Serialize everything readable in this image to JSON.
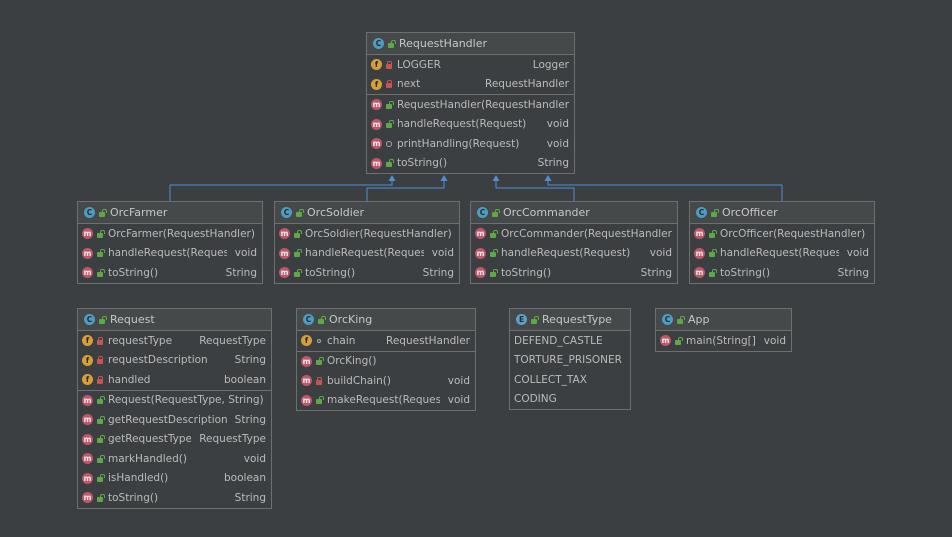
{
  "colors": {
    "background": "#3c3f41",
    "arrow": "#4f8fd8",
    "class_badge": "#4d9cc4",
    "field_badge": "#d79f39",
    "method_badge": "#c0566b"
  },
  "classes": [
    {
      "key": "request-handler",
      "name": "RequestHandler",
      "kind": "class",
      "sections": [
        [
          {
            "badge": "f",
            "vis": "priv",
            "name": "LOGGER",
            "type": "Logger"
          },
          {
            "badge": "f",
            "vis": "priv",
            "name": "next",
            "type": "RequestHandler"
          }
        ],
        [
          {
            "badge": "m",
            "vis": "pub",
            "name": "RequestHandler(RequestHandler)",
            "type": ""
          },
          {
            "badge": "m",
            "vis": "pub",
            "name": "handleRequest(Request)",
            "type": "void"
          },
          {
            "badge": "m",
            "vis": "prot",
            "name": "printHandling(Request)",
            "type": "void"
          },
          {
            "badge": "m",
            "vis": "pub",
            "name": "toString()",
            "type": "String"
          }
        ]
      ]
    },
    {
      "key": "orc-farmer",
      "name": "OrcFarmer",
      "kind": "class",
      "sections": [
        [
          {
            "badge": "m",
            "vis": "pub",
            "name": "OrcFarmer(RequestHandler)",
            "type": ""
          },
          {
            "badge": "m",
            "vis": "pub",
            "name": "handleRequest(Request)",
            "type": "void"
          },
          {
            "badge": "m",
            "vis": "pub",
            "name": "toString()",
            "type": "String"
          }
        ]
      ]
    },
    {
      "key": "orc-soldier",
      "name": "OrcSoldier",
      "kind": "class",
      "sections": [
        [
          {
            "badge": "m",
            "vis": "pub",
            "name": "OrcSoldier(RequestHandler)",
            "type": ""
          },
          {
            "badge": "m",
            "vis": "pub",
            "name": "handleRequest(Request)",
            "type": "void"
          },
          {
            "badge": "m",
            "vis": "pub",
            "name": "toString()",
            "type": "String"
          }
        ]
      ]
    },
    {
      "key": "orc-commander",
      "name": "OrcCommander",
      "kind": "class",
      "sections": [
        [
          {
            "badge": "m",
            "vis": "pub",
            "name": "OrcCommander(RequestHandler)",
            "type": ""
          },
          {
            "badge": "m",
            "vis": "pub",
            "name": "handleRequest(Request)",
            "type": "void"
          },
          {
            "badge": "m",
            "vis": "pub",
            "name": "toString()",
            "type": "String"
          }
        ]
      ]
    },
    {
      "key": "orc-officer",
      "name": "OrcOfficer",
      "kind": "class",
      "sections": [
        [
          {
            "badge": "m",
            "vis": "pub",
            "name": "OrcOfficer(RequestHandler)",
            "type": ""
          },
          {
            "badge": "m",
            "vis": "pub",
            "name": "handleRequest(Request)",
            "type": "void"
          },
          {
            "badge": "m",
            "vis": "pub",
            "name": "toString()",
            "type": "String"
          }
        ]
      ]
    },
    {
      "key": "request",
      "name": "Request",
      "kind": "class",
      "sections": [
        [
          {
            "badge": "f",
            "vis": "priv",
            "name": "requestType",
            "type": "RequestType"
          },
          {
            "badge": "f",
            "vis": "priv",
            "name": "requestDescription",
            "type": "String"
          },
          {
            "badge": "f",
            "vis": "priv",
            "name": "handled",
            "type": "boolean"
          }
        ],
        [
          {
            "badge": "m",
            "vis": "pub",
            "name": "Request(RequestType, String)",
            "type": ""
          },
          {
            "badge": "m",
            "vis": "pub",
            "name": "getRequestDescription()",
            "type": "String"
          },
          {
            "badge": "m",
            "vis": "pub",
            "name": "getRequestType()",
            "type": "RequestType"
          },
          {
            "badge": "m",
            "vis": "pub",
            "name": "markHandled()",
            "type": "void"
          },
          {
            "badge": "m",
            "vis": "pub",
            "name": "isHandled()",
            "type": "boolean"
          },
          {
            "badge": "m",
            "vis": "pub",
            "name": "toString()",
            "type": "String"
          }
        ]
      ]
    },
    {
      "key": "orc-king",
      "name": "OrcKing",
      "kind": "class",
      "sections": [
        [
          {
            "badge": "f",
            "vis": "pkg",
            "name": "chain",
            "type": "RequestHandler"
          }
        ],
        [
          {
            "badge": "m",
            "vis": "pub",
            "name": "OrcKing()",
            "type": ""
          },
          {
            "badge": "m",
            "vis": "priv",
            "name": "buildChain()",
            "type": "void"
          },
          {
            "badge": "m",
            "vis": "pub",
            "name": "makeRequest(Request)",
            "type": "void"
          }
        ]
      ]
    },
    {
      "key": "request-type",
      "name": "RequestType",
      "kind": "enum",
      "sections": [
        [
          {
            "badge": "",
            "vis": "",
            "name": "DEFEND_CASTLE",
            "type": ""
          },
          {
            "badge": "",
            "vis": "",
            "name": "TORTURE_PRISONER",
            "type": ""
          },
          {
            "badge": "",
            "vis": "",
            "name": "COLLECT_TAX",
            "type": ""
          },
          {
            "badge": "",
            "vis": "",
            "name": "CODING",
            "type": ""
          }
        ]
      ]
    },
    {
      "key": "app",
      "name": "App",
      "kind": "class",
      "sections": [
        [
          {
            "badge": "m",
            "vis": "pub",
            "name": "main(String[])",
            "type": "void"
          }
        ]
      ]
    }
  ],
  "inheritance": [
    {
      "from": "orc-farmer",
      "to": "request-handler"
    },
    {
      "from": "orc-soldier",
      "to": "request-handler"
    },
    {
      "from": "orc-commander",
      "to": "request-handler"
    },
    {
      "from": "orc-officer",
      "to": "request-handler"
    }
  ]
}
